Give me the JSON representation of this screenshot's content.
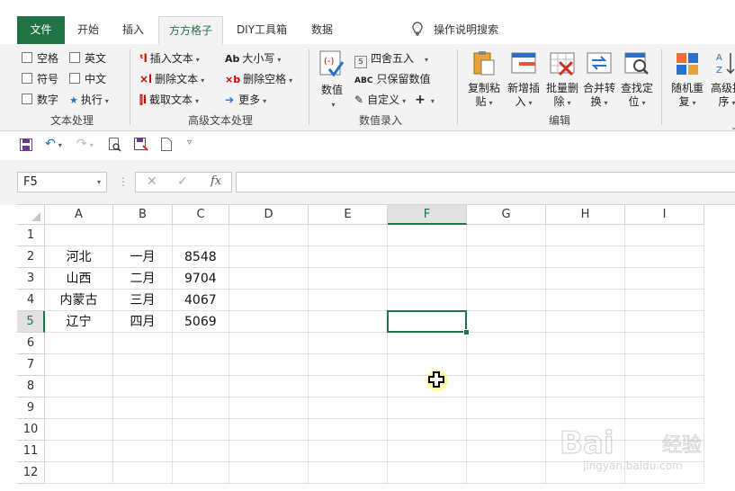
{
  "tabs": [
    {
      "label": "文件"
    },
    {
      "label": "开始"
    },
    {
      "label": "插入"
    },
    {
      "label": "方方格子"
    },
    {
      "label": "DIY工具箱"
    },
    {
      "label": "数据"
    }
  ],
  "tell_me": "操作说明搜索",
  "ribbon": {
    "text_group": {
      "label": "文本处理",
      "items": [
        "空格",
        "英文",
        "符号",
        "中文",
        "数字",
        "执行"
      ]
    },
    "adv_text_group": {
      "label": "高级文本处理",
      "items": [
        "插入文本",
        "删除文本",
        "截取文本",
        "大小写",
        "删除空格",
        "更多"
      ]
    },
    "num_group": {
      "label": "数值录入",
      "big": "数值",
      "items": [
        "四舍五入",
        "只保留数值",
        "自定义"
      ]
    },
    "edit_group": {
      "label": "编辑",
      "buttons": [
        {
          "l1": "复制粘",
          "l2": "贴"
        },
        {
          "l1": "新增插",
          "l2": "入"
        },
        {
          "l1": "批量删",
          "l2": "除"
        },
        {
          "l1": "合并转",
          "l2": "换"
        },
        {
          "l1": "查找定",
          "l2": "位"
        }
      ]
    },
    "more_buttons": [
      {
        "l1": "随机重",
        "l2": "复"
      },
      {
        "l1": "高级排",
        "l2": "序"
      }
    ]
  },
  "namebox": "F5",
  "formula": "",
  "columns": [
    "A",
    "B",
    "C",
    "D",
    "E",
    "F",
    "G",
    "H",
    "I"
  ],
  "rows": [
    "1",
    "2",
    "3",
    "4",
    "5",
    "6",
    "7",
    "8",
    "9",
    "10",
    "11",
    "12"
  ],
  "cells": [
    {
      "row": 2,
      "col": "A",
      "value": "河北"
    },
    {
      "row": 2,
      "col": "B",
      "value": "一月"
    },
    {
      "row": 2,
      "col": "C",
      "value": "8548"
    },
    {
      "row": 3,
      "col": "A",
      "value": "山西"
    },
    {
      "row": 3,
      "col": "B",
      "value": "二月"
    },
    {
      "row": 3,
      "col": "C",
      "value": "9704"
    },
    {
      "row": 4,
      "col": "A",
      "value": "内蒙古"
    },
    {
      "row": 4,
      "col": "B",
      "value": "三月"
    },
    {
      "row": 4,
      "col": "C",
      "value": "4067"
    },
    {
      "row": 5,
      "col": "A",
      "value": "辽宁"
    },
    {
      "row": 5,
      "col": "B",
      "value": "四月"
    },
    {
      "row": 5,
      "col": "C",
      "value": "5069"
    }
  ],
  "selected": {
    "col": "F",
    "row": 5
  },
  "watermark": "Bai du 经验 jingyan.baidu.com",
  "colors": {
    "accent": "#217346"
  }
}
